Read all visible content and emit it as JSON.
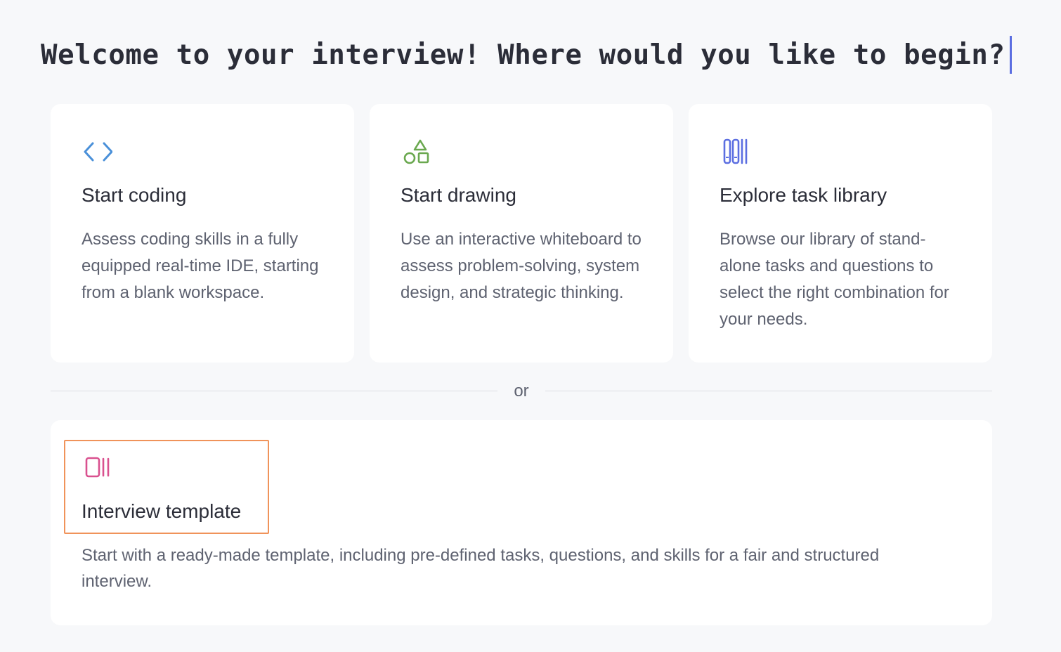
{
  "headline": {
    "text": "Welcome to your interview! Where would you like to begin?"
  },
  "options": {
    "coding": {
      "icon": "code-brackets-icon",
      "title": "Start coding",
      "description": "Assess coding skills in a fully equipped real-time IDE, starting from a blank workspace."
    },
    "drawing": {
      "icon": "shapes-icon",
      "title": "Start drawing",
      "description": "Use an interactive whiteboard to assess problem-solving, system design, and strategic thinking."
    },
    "library": {
      "icon": "books-icon",
      "title": "Explore task library",
      "description": "Browse our library of stand-alone tasks and questions to select the right combination for your needs."
    }
  },
  "divider": {
    "label": "or"
  },
  "template": {
    "icon": "template-stack-icon",
    "title": "Interview template",
    "description": "Start with a ready-made template, including pre-defined tasks, questions, and skills for a fair and structured interview."
  },
  "colors": {
    "background": "#f7f8fa",
    "card": "#ffffff",
    "coding_icon": "#4a90d9",
    "drawing_icon": "#6aa84f",
    "library_icon": "#5b6ee1",
    "template_icon": "#d9518f",
    "focus_outline": "#f0935a",
    "cursor": "#5b6ee1"
  }
}
